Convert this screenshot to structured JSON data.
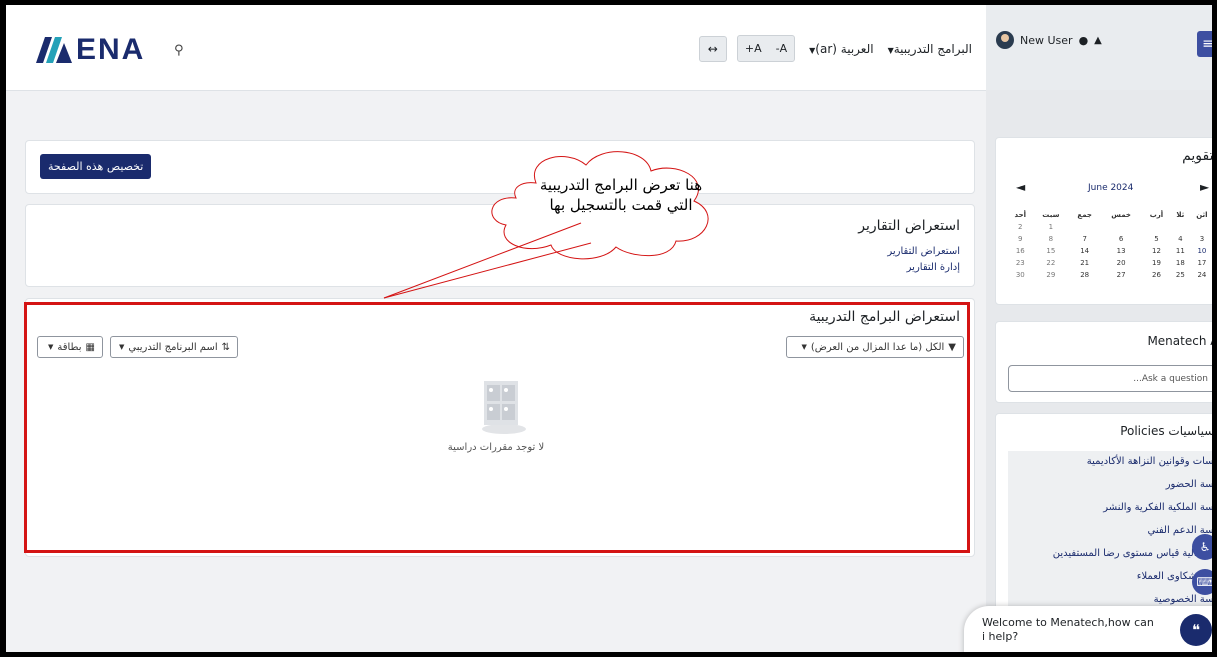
{
  "navbar": {
    "logo_text": "ENA",
    "programs_label": "البرامج التدريبية",
    "language_label": "العربية (ar)",
    "font_decrease": "A-",
    "font_increase": "A+",
    "resize_icon": "↔"
  },
  "page": {
    "customize_button": "تخصيص هذه الصفحة",
    "reports_title": "استعراض التقارير",
    "reports_links": [
      "استعراض التقارير",
      "إدارة التقارير"
    ],
    "programs_title": "استعراض البرامج التدريبية",
    "filter_all": "الكل (ما عدا المزال من العرض)",
    "sort_label": "اسم البرنامج التدريبي",
    "view_label": "بطاقة",
    "empty_text": "لا توجد مقررات دراسية"
  },
  "annotation": {
    "bubble_text": "هنا تعرض البرامج التدريبية التي قمت بالتسجيل بها",
    "bubble_color": "#d41414"
  },
  "sidebar": {
    "user_name": "New User",
    "calendar": {
      "title": "التقويم",
      "month": "June 2024",
      "weekdays": [
        "اثن",
        "ثلا",
        "أرب",
        "خمس",
        "جمع",
        "سبت",
        "أحد"
      ],
      "weeks": [
        [
          "",
          "",
          "",
          "",
          "",
          "1",
          "2"
        ],
        [
          "3",
          "4",
          "5",
          "6",
          "7",
          "8",
          "9"
        ],
        [
          "10",
          "11",
          "12",
          "13",
          "14",
          "15",
          "16"
        ],
        [
          "17",
          "18",
          "19",
          "20",
          "21",
          "22",
          "23"
        ],
        [
          "24",
          "25",
          "26",
          "27",
          "28",
          "29",
          "30"
        ]
      ]
    },
    "ai": {
      "title": "Menatech AI",
      "placeholder": "Ask a question..."
    },
    "policies": {
      "title": "السياسيات Policies",
      "items": [
        "سياسات وقوانين النزاهة الأكاديمية",
        "سياسة الحضور",
        "سياسة الملكية الفكرية والنشر",
        "سياسة الدعم الفني",
        "سياسة آلية قياس مستوى رضا المستفيدين",
        "سياسة شكاوى العملاء",
        "سياسة الخصوصية"
      ]
    }
  },
  "chat": {
    "welcome_text": "Welcome to Menatech,how can i help?"
  },
  "colors": {
    "brand": "#1a2b6d",
    "accent": "#3d4fa1",
    "highlight_red": "#d41414"
  }
}
